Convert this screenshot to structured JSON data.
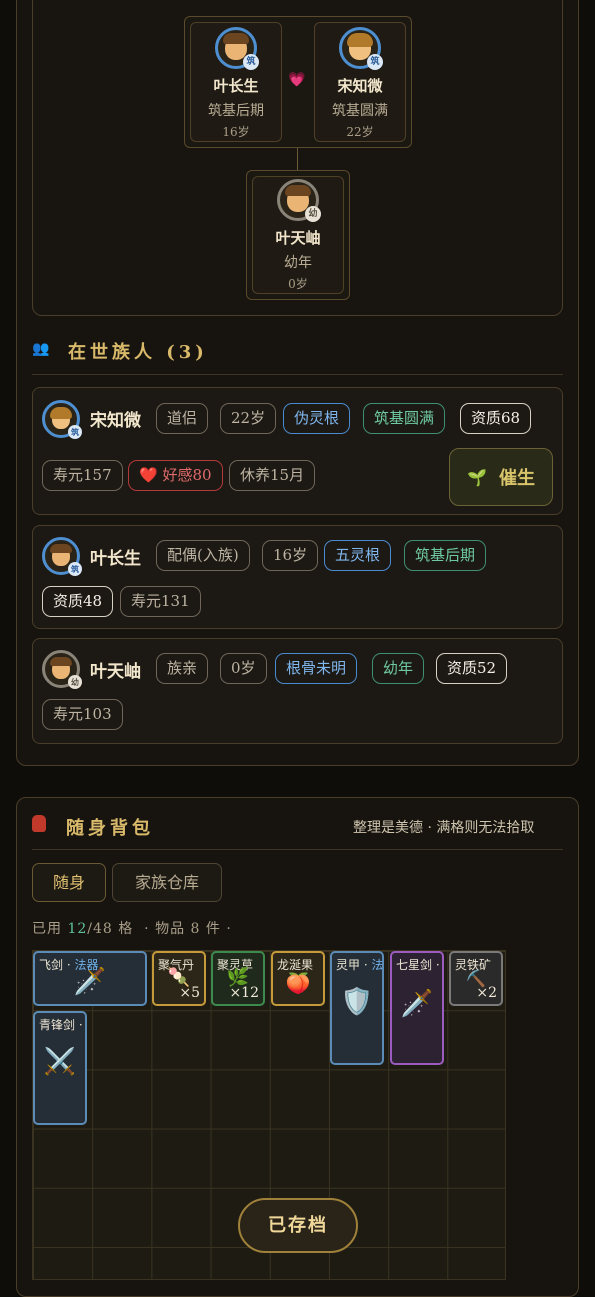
{
  "tree": {
    "father": {
      "name": "叶长生",
      "stage": "筑基后期",
      "age": "16岁",
      "badge": "筑"
    },
    "mother": {
      "name": "宋知微",
      "stage": "筑基圆满",
      "age": "22岁",
      "badge": "筑"
    },
    "child": {
      "name": "叶天岫",
      "stage": "幼年",
      "age": "0岁",
      "badge": "幼"
    },
    "heart_icon": "heart-icon"
  },
  "members_section": {
    "title": "在世族人 (3)",
    "icon": "people-icon"
  },
  "members": [
    {
      "name": "宋知微",
      "badge": "筑",
      "role": "道侣",
      "age": "22岁",
      "root": "伪灵根",
      "stage": "筑基圆满",
      "aptitude": "资质68",
      "lifespan": "寿元157",
      "affection": "好感80",
      "rest": "休养15月"
    },
    {
      "name": "叶长生",
      "badge": "筑",
      "role": "配偶(入族)",
      "age": "16岁",
      "root": "五灵根",
      "stage": "筑基后期",
      "aptitude": "资质48",
      "lifespan": "寿元131"
    },
    {
      "name": "叶天岫",
      "badge": "幼",
      "role": "族亲",
      "age": "0岁",
      "root": "根骨未明",
      "stage": "幼年",
      "aptitude": "资质52",
      "lifespan": "寿元103"
    }
  ],
  "breed_button": {
    "label": "催生",
    "icon": "sprout-icon"
  },
  "bag": {
    "title": "随身背包",
    "icon": "backpack-icon",
    "note": "整理是美德 · 满格则无法拾取",
    "tabs": [
      "随身",
      "家族仓库"
    ],
    "used_prefix": "已用",
    "used": "12",
    "capacity": "/48 格",
    "items_text": "· 物品 8 件 ·",
    "items": [
      {
        "name": "飞剑 · ",
        "type": "法器",
        "icon": "sword-icon"
      },
      {
        "name": "聚气丹",
        "count": "×5",
        "icon": "pill-icon"
      },
      {
        "name": "聚灵草",
        "count": "×12",
        "icon": "herb-icon"
      },
      {
        "name": "龙涎果",
        "icon": "fruit-icon"
      },
      {
        "name": "灵甲 · ",
        "type": "法",
        "icon": "shield-icon"
      },
      {
        "name": "七星剑 · ",
        "icon": "dagger-icon"
      },
      {
        "name": "灵铁矿",
        "count": "×2",
        "icon": "ore-icon"
      },
      {
        "name": "青锋剑 · ",
        "icon": "crossed-swords-icon"
      }
    ]
  },
  "save_button": {
    "label": "已存档"
  }
}
